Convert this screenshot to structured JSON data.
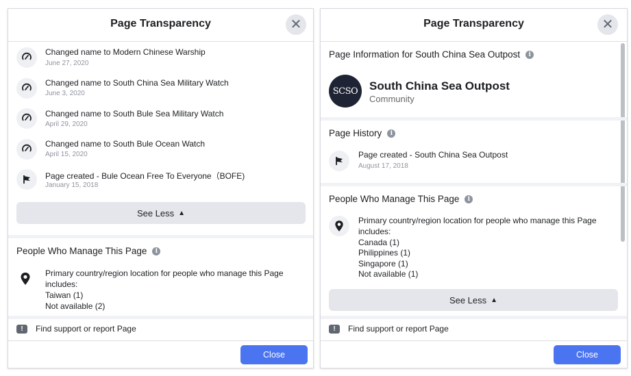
{
  "left": {
    "title": "Page Transparency",
    "close_glyph": "✕",
    "history": [
      {
        "prefix": "Changed name to ",
        "name": "Modern Chinese Warship",
        "date": "June 27, 2020",
        "icon": "rename-icon"
      },
      {
        "prefix": "Changed name to ",
        "name": "South China Sea Military Watch",
        "date": "June 3, 2020",
        "icon": "rename-icon"
      },
      {
        "prefix": "Changed name to ",
        "name": "South Bule Sea Military Watch",
        "date": "April 29, 2020",
        "icon": "rename-icon"
      },
      {
        "prefix": "Changed name to ",
        "name": "South Bule Ocean Watch",
        "date": "April 15, 2020",
        "icon": "rename-icon"
      },
      {
        "prefix": "Page created - ",
        "name": "Bule Ocean Free To Everyone（BOFE)",
        "date": "January 15, 2018",
        "icon": "flag-icon"
      }
    ],
    "see_less": "See Less",
    "people": {
      "title": "People Who Manage This Page",
      "intro_line1": "Primary country/region location for people who manage this Page",
      "intro_line2": "includes:",
      "countries": [
        "Taiwan (1)",
        "Not available (2)"
      ]
    },
    "report": "Find support or report Page",
    "close_button": "Close"
  },
  "right": {
    "title": "Page Transparency",
    "close_glyph": "✕",
    "info_title": "Page Information for South China Sea Outpost",
    "avatar_text": "SCSO",
    "page_name": "South China Sea Outpost",
    "page_category": "Community",
    "history_title": "Page History",
    "history": [
      {
        "prefix": "Page created - ",
        "name": "South China Sea Outpost",
        "date": "August 17, 2018",
        "icon": "flag-icon"
      }
    ],
    "people": {
      "title": "People Who Manage This Page",
      "intro_line1": "Primary country/region location for people who manage this Page",
      "intro_line2": "includes:",
      "countries": [
        "Canada (1)",
        "Philippines (1)",
        "Singapore (1)",
        "Not available (1)"
      ]
    },
    "see_less": "See Less",
    "report": "Find support or report Page",
    "close_button": "Close"
  },
  "colors": {
    "accent": "#4b74f0",
    "divider": "#f0f2f5",
    "secondary_text": "#8d949e",
    "avatar_bg": "#1e2433"
  }
}
